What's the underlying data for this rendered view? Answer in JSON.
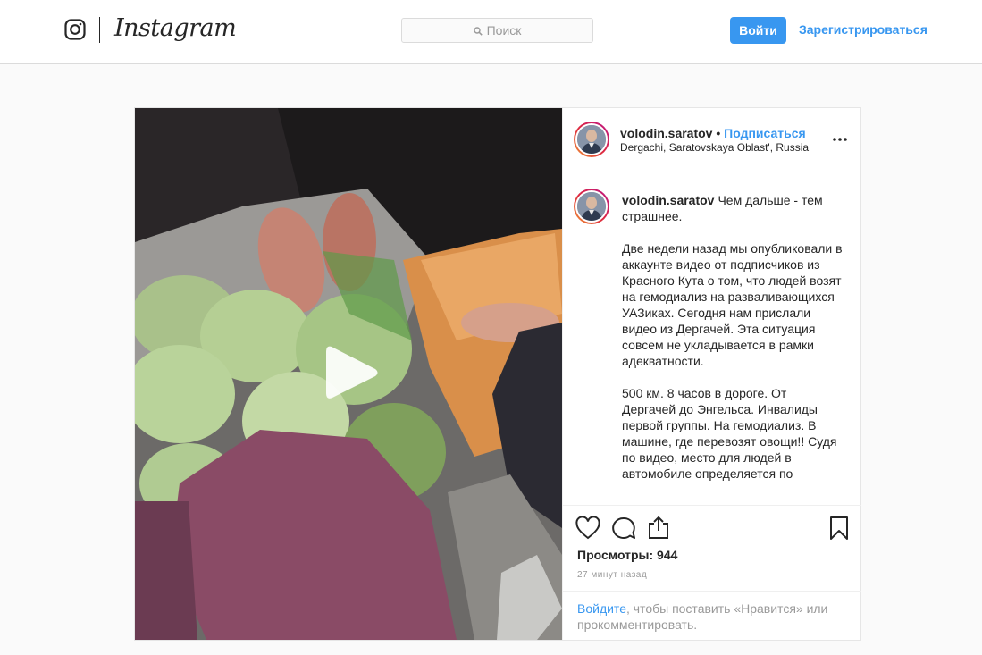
{
  "header": {
    "brand": "Instagram",
    "search_placeholder": "Поиск",
    "login_label": "Войти",
    "signup_label": "Зарегистрироваться",
    "icons": {
      "logo": "instagram-camera-icon",
      "search": "search-icon"
    }
  },
  "post": {
    "username": "volodin.saratov",
    "separator": "•",
    "follow_label": "Подписаться",
    "location": "Dergachi, Saratovskaya Oblast', Russia",
    "media_type": "video",
    "caption": "Чем дальше - тем страшнее.\n\nДве недели назад мы опубликовали в аккаунте видео от подписчиков из Красного Кута о том, что людей возят на гемодиализ на разваливающихся УАЗиках. Сегодня нам прислали видео из Дергачей. Эта ситуация совсем не укладывается в рамки адекватности.\n\n500 км. 8 часов в дороге. От Дергачей до Энгельса. Инвалиды первой группы. На гемодиализ. В машине, где перевозят овощи!! Судя по видео, место для людей в автомобиле определяется по",
    "views_text": "Просмотры: 944",
    "timestamp": "27 минут назад",
    "login_prompt": {
      "link": "Войдите",
      "rest": ", чтобы поставить «Нравится» или прокомментировать."
    },
    "icons": [
      "more-options-icon",
      "play-icon",
      "heart-icon",
      "comment-icon",
      "share-icon",
      "bookmark-icon"
    ]
  },
  "colors": {
    "accent": "#3897f0",
    "text": "#262626",
    "muted": "#999999",
    "border": "#dbdbdb"
  }
}
